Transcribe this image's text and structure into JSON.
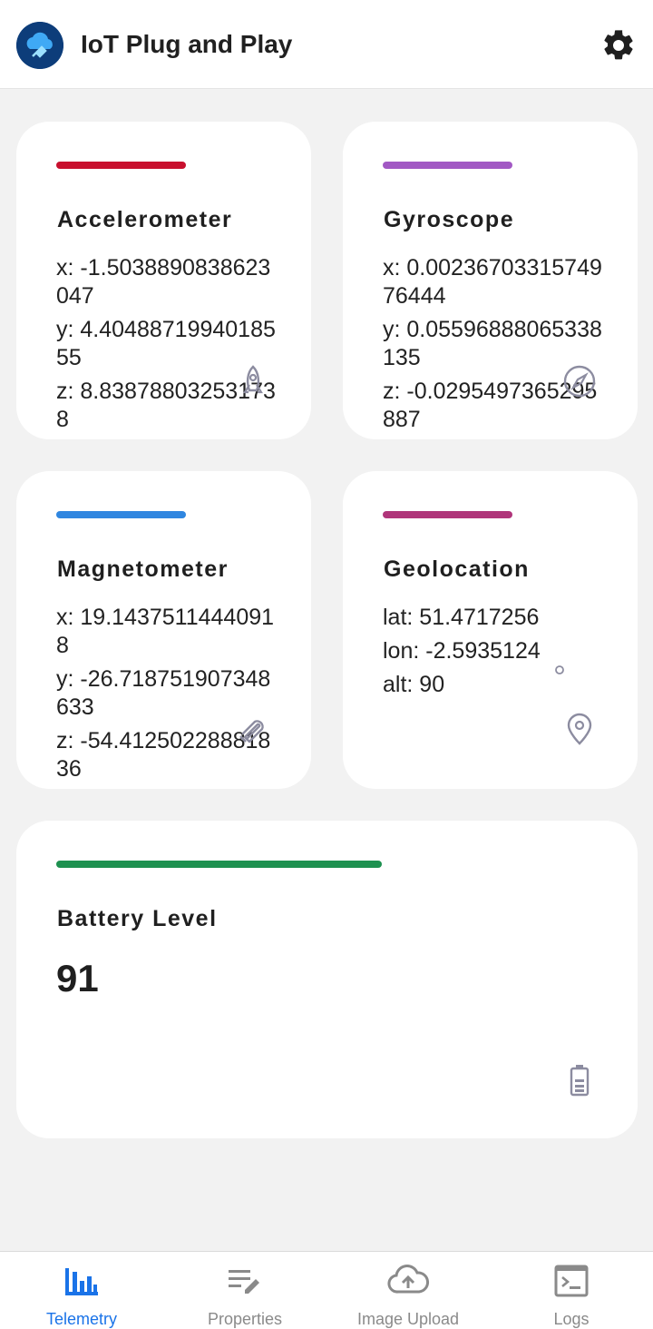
{
  "header": {
    "title": "IoT Plug and Play"
  },
  "cards": {
    "accelerometer": {
      "title": "Accelerometer",
      "accent": "#c8102e",
      "x": "x: -1.5038890838623047",
      "y": "y: 4.4048871994018555",
      "z": "z: 8.838788032531738",
      "icon": "rocket-icon"
    },
    "gyroscope": {
      "title": "Gyroscope",
      "accent": "#a259c4",
      "x": "x: 0.0023670331574976444",
      "y": "y: 0.05596888065338135",
      "z": "z: -0.0295497365295887",
      "icon": "compass-icon"
    },
    "magnetometer": {
      "title": "Magnetometer",
      "accent": "#2f86e0",
      "x": "x: 19.14375114440918",
      "y": "y: -26.718751907348633",
      "z": "z: -54.41250228881836",
      "icon": "magnet-icon"
    },
    "geolocation": {
      "title": "Geolocation",
      "accent": "#b0357a",
      "lat": "lat: 51.4717256",
      "lon": "lon: -2.5935124",
      "alt": "alt: 90",
      "icon": "location-pin-icon"
    },
    "battery": {
      "title": "Battery Level",
      "accent": "#1e9150",
      "value": "91",
      "progress_percent": 91,
      "icon": "battery-icon"
    }
  },
  "bottom_nav": {
    "telemetry": "Telemetry",
    "properties": "Properties",
    "image_upload": "Image Upload",
    "logs": "Logs",
    "active": "telemetry",
    "active_color": "#1a73e8",
    "inactive_color": "#8a8a8a"
  }
}
